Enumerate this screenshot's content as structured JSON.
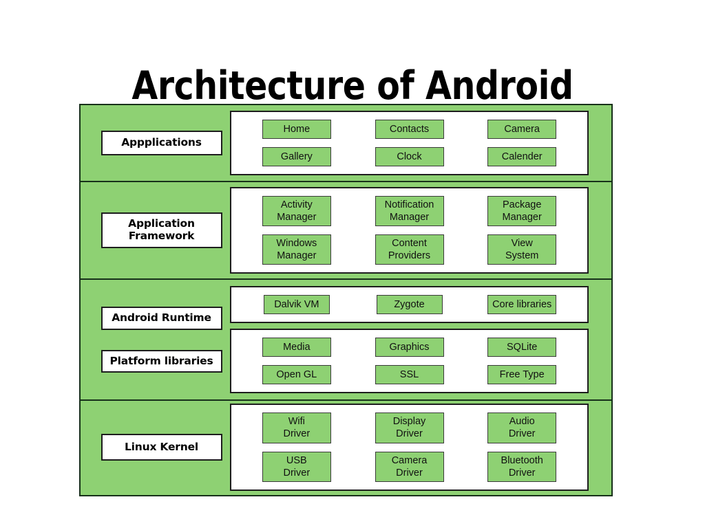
{
  "title": "Architecture of Android",
  "colors": {
    "layer_green": "#8ed173",
    "chip_green": "#8ed173",
    "panel_white": "#ffffff",
    "border_dark": "#17301a",
    "text_black": "#000000",
    "page_background": "#ffffff"
  },
  "layers": [
    {
      "id": "applications",
      "label": "Appplications",
      "panels": [
        {
          "id": "applications-panel",
          "rows": [
            [
              "Home",
              "Contacts",
              "Camera"
            ],
            [
              "Gallery",
              "Clock",
              "Calender"
            ]
          ]
        }
      ]
    },
    {
      "id": "application-framework",
      "label": "Application\nFramework",
      "panels": [
        {
          "id": "framework-panel",
          "rows": [
            [
              "Activity\nManager",
              "Notification\nManager",
              "Package\nManager"
            ],
            [
              "Windows\nManager",
              "Content\nProviders",
              "View\nSystem"
            ]
          ]
        }
      ]
    },
    {
      "id": "libraries",
      "labels": [
        "Android Runtime",
        "Platform libraries"
      ],
      "panels": [
        {
          "id": "android-runtime-panel",
          "rows": [
            [
              "Dalvik VM",
              "Zygote",
              "Core libraries"
            ]
          ]
        },
        {
          "id": "platform-libraries-panel",
          "rows": [
            [
              "Media",
              "Graphics",
              "SQLite"
            ],
            [
              "Open GL",
              "SSL",
              "Free Type"
            ]
          ]
        }
      ]
    },
    {
      "id": "linux-kernel",
      "label": "Linux Kernel",
      "panels": [
        {
          "id": "kernel-panel",
          "rows": [
            [
              "Wifi\nDriver",
              "Display\nDriver",
              "Audio\nDriver"
            ],
            [
              "USB\nDriver",
              "Camera\nDriver",
              "Bluetooth\nDriver"
            ]
          ]
        }
      ]
    }
  ]
}
